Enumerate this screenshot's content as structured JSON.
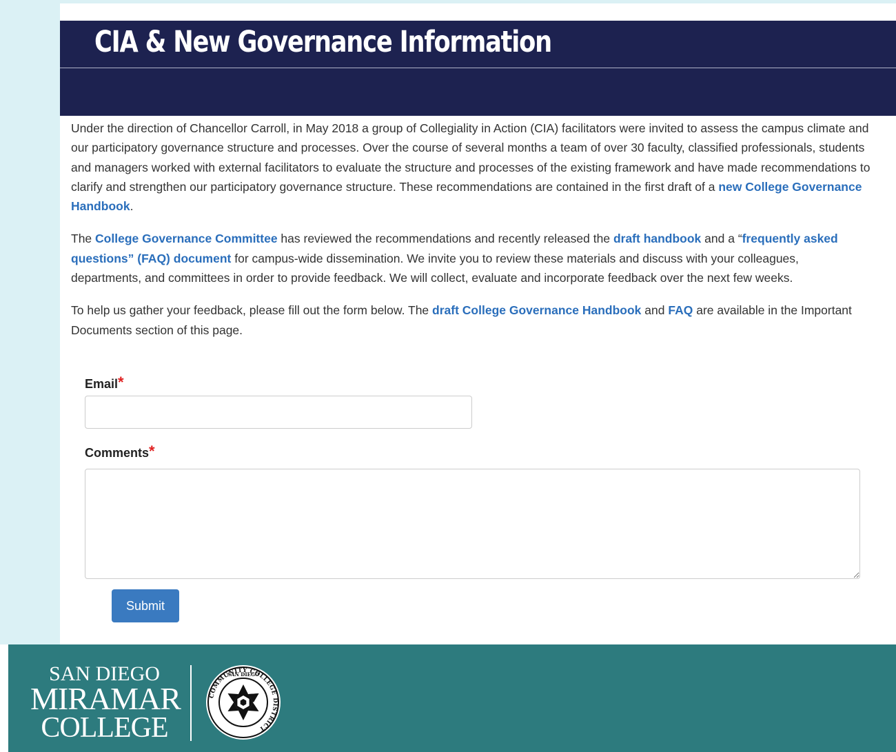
{
  "header": {
    "title": "CIA & New Governance Information"
  },
  "intro": {
    "p1": {
      "text_a": "Under the direction of Chancellor Carroll, in May 2018 a group of Collegiality in Action (CIA) facilitators were invited to assess the campus climate and our participatory governance structure and processes. Over the course of several months a team of over 30 faculty, classified professionals, students and managers worked with external facilitators to evaluate the structure and processes of the existing framework and have made recommendations to clarify and strengthen our participatory governance structure. These recommendations are contained in the first draft of a ",
      "link_handbook": "new College Governance Handbook",
      "text_b": "."
    },
    "p2": {
      "text_a": "The ",
      "link_committee": "College Governance Committee",
      "text_b": " has reviewed the recommendations and recently released the ",
      "link_draft": "draft handbook",
      "text_c": " and a “",
      "link_faq": "frequently asked questions” (FAQ) document",
      "text_d": " for campus-wide dissemination. We invite you to review these materials and discuss with your colleagues, departments, and committees in order to provide feedback. We will collect, evaluate and incorporate feedback over the next few weeks."
    },
    "p3": {
      "text_a": "To help us gather your feedback, please fill out the form below. The ",
      "link_handbook": "draft College Governance Handbook",
      "text_b": " and ",
      "link_faq": "FAQ",
      "text_c": " are available in the Important Documents section of this page."
    }
  },
  "form": {
    "email_label": "Email",
    "email_value": "",
    "comments_label": "Comments",
    "comments_value": "",
    "required_marker": "*",
    "submit_label": "Submit"
  },
  "footer": {
    "logo_line1": "SAN DIEGO",
    "logo_line2": "MIRAMAR",
    "logo_line3": "COLLEGE",
    "seal_top_text": "SAN DIEGO",
    "seal_ring_text": "COMMUNITY COLLEGE DISTRICT"
  },
  "colors": {
    "header_bg": "#1d2250",
    "page_bg": "#dbf1f5",
    "link": "#2a6ebb",
    "required": "#e02020",
    "submit_bg": "#3a7ac0",
    "footer_bg": "#2d7b7e"
  }
}
